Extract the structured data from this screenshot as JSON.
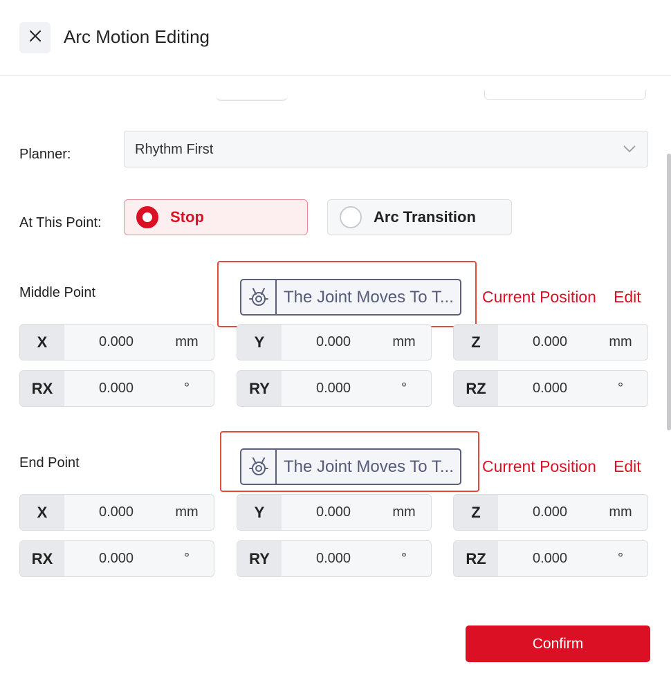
{
  "dialog": {
    "title": "Arc Motion Editing"
  },
  "planner": {
    "label": "Planner:",
    "value": "Rhythm First"
  },
  "at_this_point": {
    "label": "At This Point:",
    "options": [
      {
        "label": "Stop",
        "selected": true
      },
      {
        "label": "Arc Transition",
        "selected": false
      }
    ]
  },
  "middle_point": {
    "label": "Middle Point",
    "joint_button": "The Joint Moves To T...",
    "current_position": "Current Position",
    "edit": "Edit",
    "fields": [
      {
        "tag": "X",
        "value": "0.000",
        "unit": "mm"
      },
      {
        "tag": "Y",
        "value": "0.000",
        "unit": "mm"
      },
      {
        "tag": "Z",
        "value": "0.000",
        "unit": "mm"
      },
      {
        "tag": "RX",
        "value": "0.000",
        "unit": "°"
      },
      {
        "tag": "RY",
        "value": "0.000",
        "unit": "°"
      },
      {
        "tag": "RZ",
        "value": "0.000",
        "unit": "°"
      }
    ]
  },
  "end_point": {
    "label": "End Point",
    "joint_button": "The Joint Moves To T...",
    "current_position": "Current Position",
    "edit": "Edit",
    "fields": [
      {
        "tag": "X",
        "value": "0.000",
        "unit": "mm"
      },
      {
        "tag": "Y",
        "value": "0.000",
        "unit": "mm"
      },
      {
        "tag": "Z",
        "value": "0.000",
        "unit": "mm"
      },
      {
        "tag": "RX",
        "value": "0.000",
        "unit": "°"
      },
      {
        "tag": "RY",
        "value": "0.000",
        "unit": "°"
      },
      {
        "tag": "RZ",
        "value": "0.000",
        "unit": "°"
      }
    ]
  },
  "footer": {
    "confirm_label": "Confirm"
  },
  "colors": {
    "accent": "#dc1024",
    "highlight_box": "#e24a3a",
    "joint_button_border": "#5a607c"
  },
  "icons": {
    "close": "close-icon",
    "dropdown": "chevron-down-icon",
    "joint": "robot-joint-icon"
  }
}
